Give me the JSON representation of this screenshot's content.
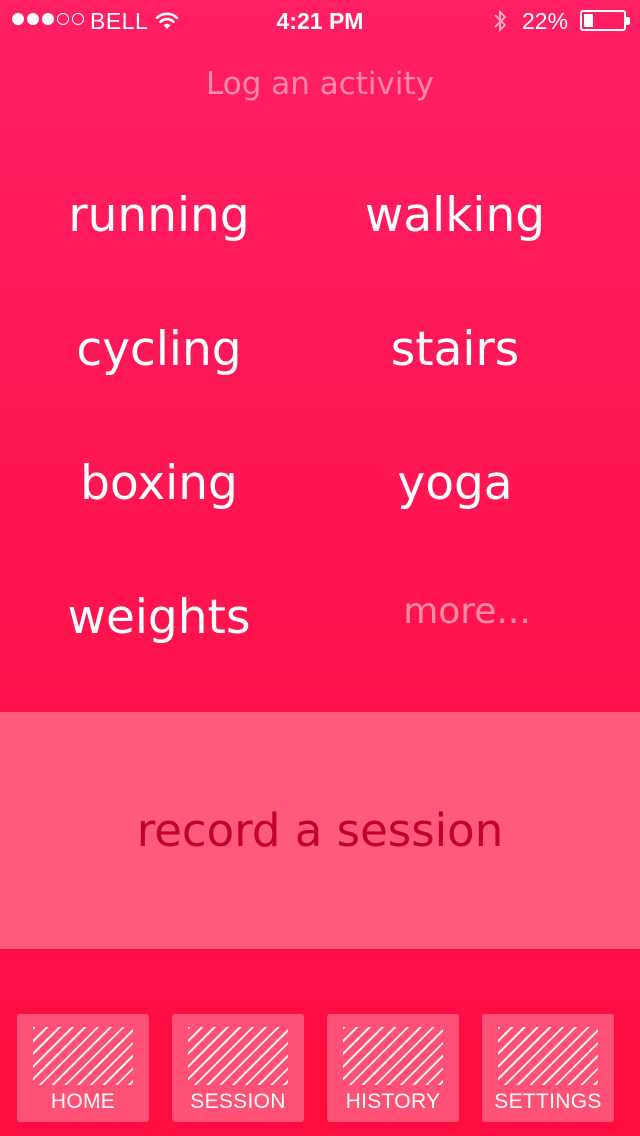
{
  "status_bar": {
    "carrier": "BELL",
    "time": "4:21 PM",
    "battery_percent": "22%",
    "signal_strength": 3,
    "signal_total": 5,
    "battery_level": 0.22,
    "icons": [
      "wifi-icon",
      "bluetooth-icon",
      "battery-icon"
    ]
  },
  "title": "Log an activity",
  "activities": [
    {
      "label": "running"
    },
    {
      "label": "walking"
    },
    {
      "label": "cycling"
    },
    {
      "label": "stairs"
    },
    {
      "label": "boxing"
    },
    {
      "label": "yoga"
    },
    {
      "label": "weights"
    },
    {
      "label": "more..."
    }
  ],
  "record_session": {
    "label": "record a session"
  },
  "tabs": [
    {
      "label": "HOME"
    },
    {
      "label": "SESSION"
    },
    {
      "label": "HISTORY"
    },
    {
      "label": "SETTINGS"
    }
  ],
  "colors": {
    "background": "#ff1552",
    "title": "#ff8aa8",
    "record_background": "#ff5a7a",
    "record_text": "#c2002a",
    "more_text": "#ff8ca7"
  }
}
